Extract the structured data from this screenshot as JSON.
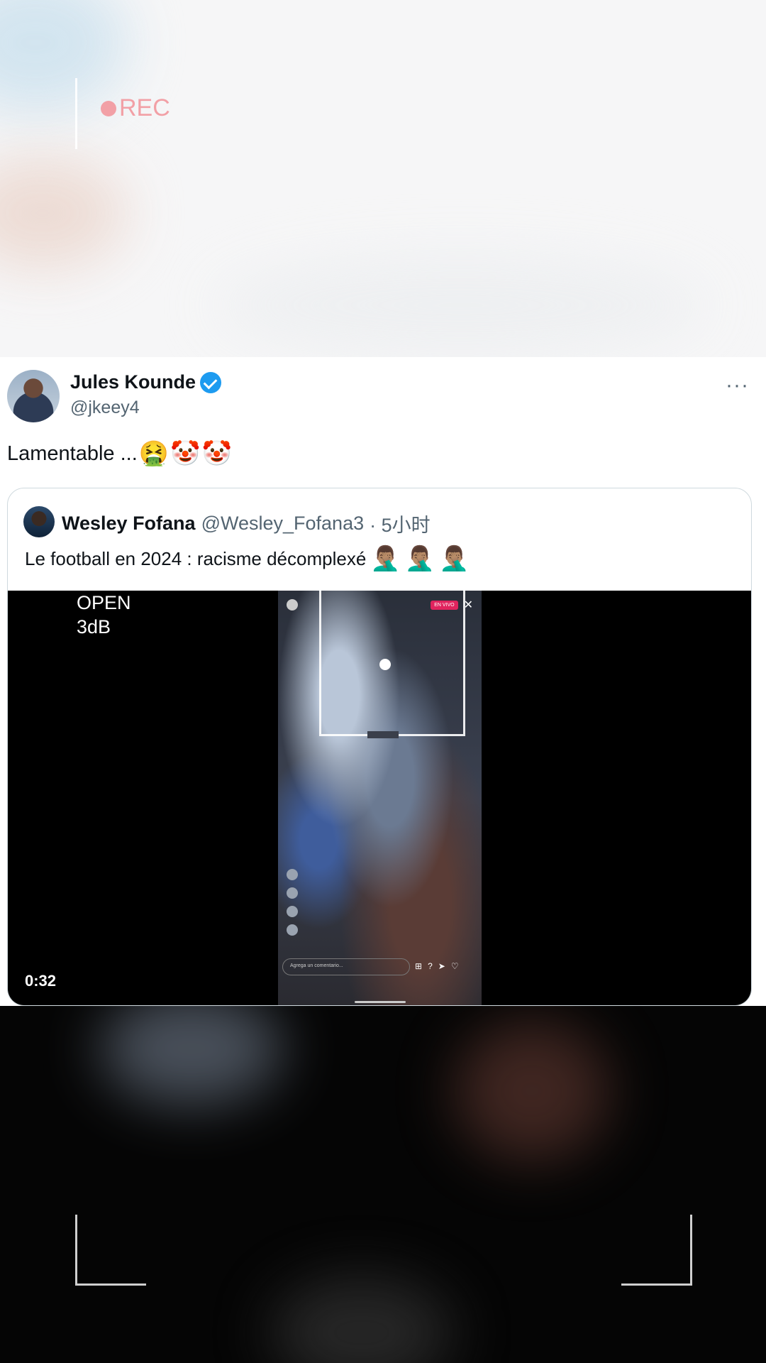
{
  "overlay": {
    "rec_label": "REC",
    "open_label": "OPEN",
    "gain_label": "3dB"
  },
  "tweet": {
    "author_name": "Jules Kounde",
    "author_handle": "@jkeey4",
    "more_label": "···",
    "text": "Lamentable ...",
    "emojis": [
      "🤮",
      "🤡",
      "🤡"
    ]
  },
  "quoted_tweet": {
    "author_name": "Wesley Fofana",
    "author_handle": "@Wesley_Fofana3",
    "time": "· 5小时",
    "text": "Le football en 2024 : racisme décomplexé",
    "emojis": [
      "🤦🏽‍♂️",
      "🤦🏽‍♂️",
      "🤦🏽‍♂️"
    ],
    "video": {
      "duration": "0:32",
      "phone_comment_placeholder": "Agrega un comentario...",
      "phone_live_badge": "EN VIVO"
    }
  },
  "colors": {
    "verified_blue": "#1d9bf0",
    "rec_pink": "#f2a0a6",
    "text_primary": "#0f1419",
    "text_secondary": "#536471"
  }
}
